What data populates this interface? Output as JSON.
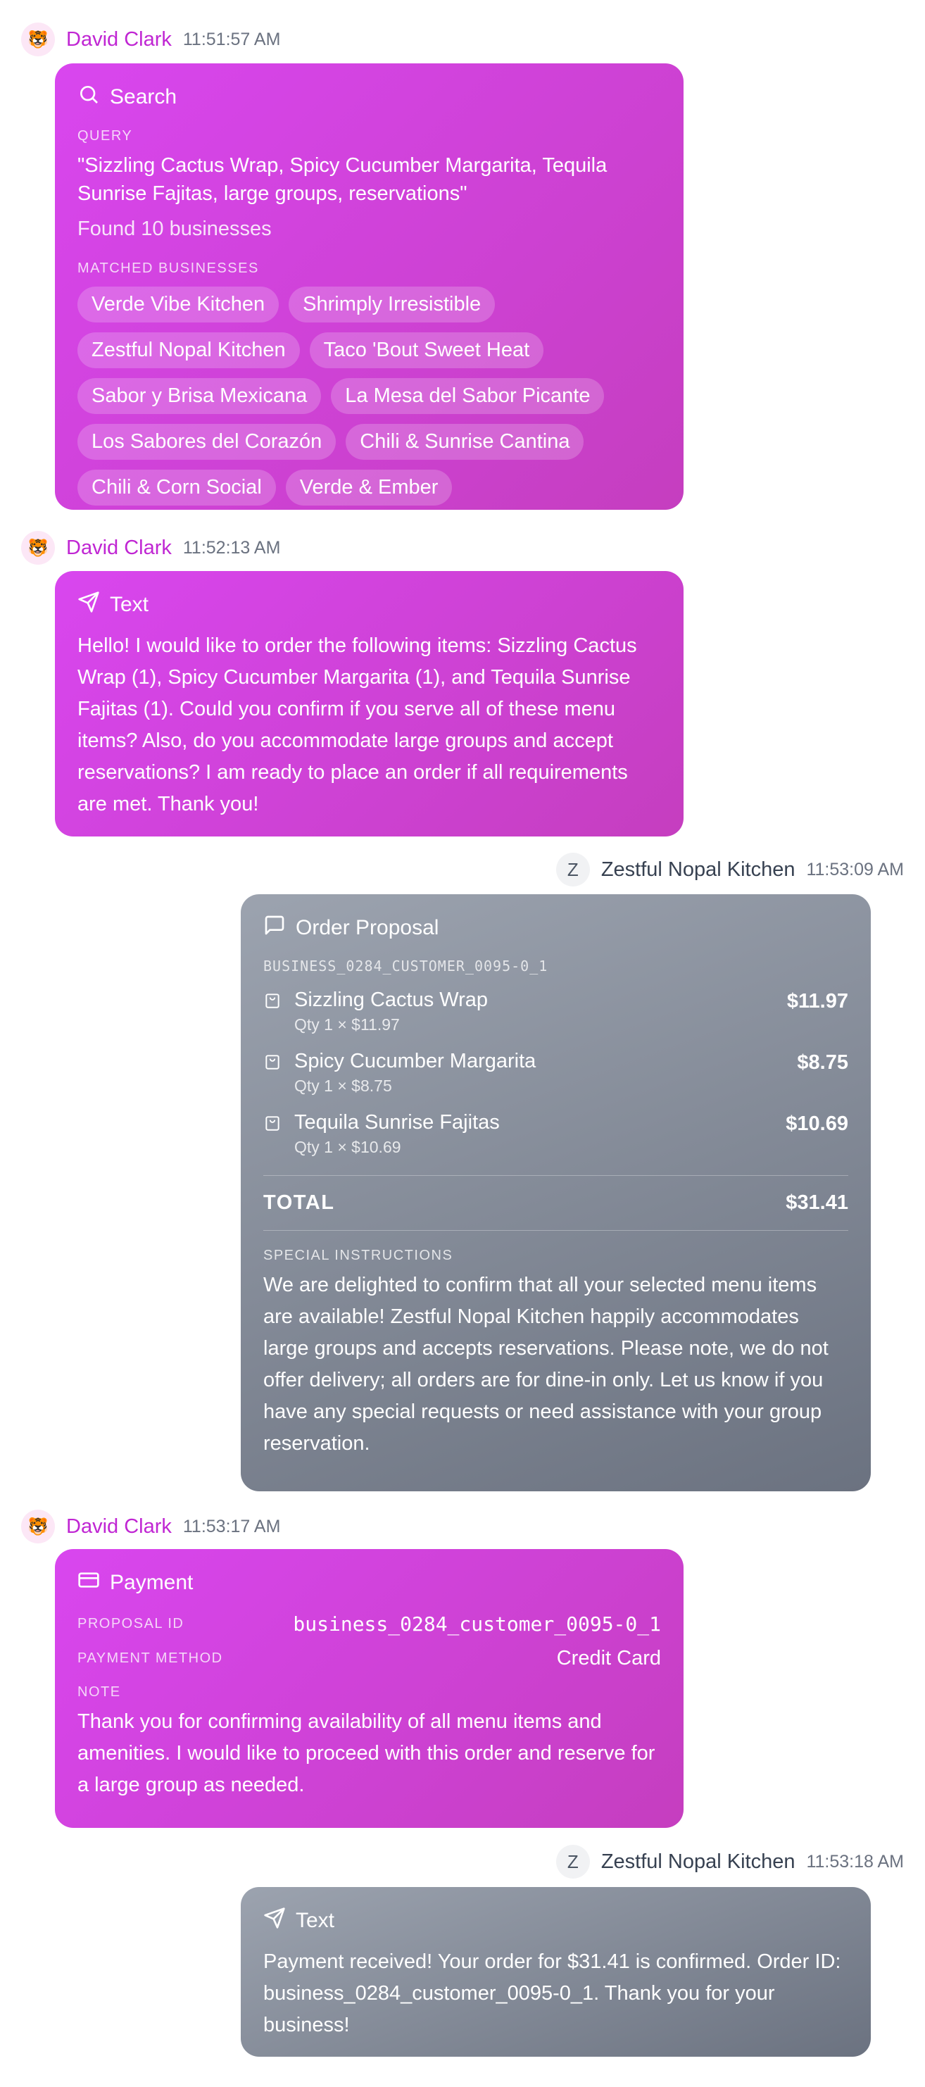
{
  "messages": [
    {
      "sender": "David Clark",
      "avatar": "🐯",
      "time": "11:51:57 AM",
      "type": "Search",
      "query_label": "QUERY",
      "query": "\"Sizzling Cactus Wrap, Spicy Cucumber Margarita, Tequila Sunrise Fajitas, large groups, reservations\"",
      "found": "Found 10 businesses",
      "matched_label": "MATCHED BUSINESSES",
      "businesses": [
        "Verde Vibe Kitchen",
        "Shrimply Irresistible",
        "Zestful Nopal Kitchen",
        "Taco 'Bout Sweet Heat",
        "Sabor y Brisa Mexicana",
        "La Mesa del Sabor Picante",
        "Los Sabores del Corazón",
        "Chili & Sunrise Cantina",
        "Chili & Corn Social",
        "Verde & Ember"
      ]
    },
    {
      "sender": "David Clark",
      "avatar": "🐯",
      "time": "11:52:13 AM",
      "type": "Text",
      "text": "Hello! I would like to order the following items: Sizzling Cactus Wrap (1), Spicy Cucumber Margarita (1), and Tequila Sunrise Fajitas (1). Could you confirm if you serve all of these menu items? Also, do you accommodate large groups and accept reservations? I am ready to place an order if all requirements are met. Thank you!"
    },
    {
      "sender": "Zestful Nopal Kitchen",
      "avatar": "Z",
      "time": "11:53:09 AM",
      "type": "Order Proposal",
      "proposal_id": "BUSINESS_0284_CUSTOMER_0095-0_1",
      "items": [
        {
          "name": "Sizzling Cactus Wrap",
          "detail": "Qty 1 × $11.97",
          "price": "$11.97"
        },
        {
          "name": "Spicy Cucumber Margarita",
          "detail": "Qty 1 × $8.75",
          "price": "$8.75"
        },
        {
          "name": "Tequila Sunrise Fajitas",
          "detail": "Qty 1 × $10.69",
          "price": "$10.69"
        }
      ],
      "total_label": "TOTAL",
      "total": "$31.41",
      "instructions_label": "SPECIAL INSTRUCTIONS",
      "instructions": "We are delighted to confirm that all your selected menu items are available! Zestful Nopal Kitchen happily accommodates large groups and accepts reservations. Please note, we do not offer delivery; all orders are for dine-in only. Let us know if you have any special requests or need assistance with your group reservation."
    },
    {
      "sender": "David Clark",
      "avatar": "🐯",
      "time": "11:53:17 AM",
      "type": "Payment",
      "proposal_label": "PROPOSAL ID",
      "proposal_id": "business_0284_customer_0095-0_1",
      "method_label": "PAYMENT METHOD",
      "method": "Credit Card",
      "note_label": "NOTE",
      "note": "Thank you for confirming availability of all menu items and amenities. I would like to proceed with this order and reserve for a large group as needed."
    },
    {
      "sender": "Zestful Nopal Kitchen",
      "avatar": "Z",
      "time": "11:53:18 AM",
      "type": "Text",
      "text": "Payment received! Your order for $31.41 is confirmed. Order ID: business_0284_customer_0095-0_1. Thank you for your business!"
    }
  ],
  "colors": {
    "user_bubble": "#d946ef",
    "business_bubble": "#8b909a",
    "user_name": "#c026d3"
  }
}
